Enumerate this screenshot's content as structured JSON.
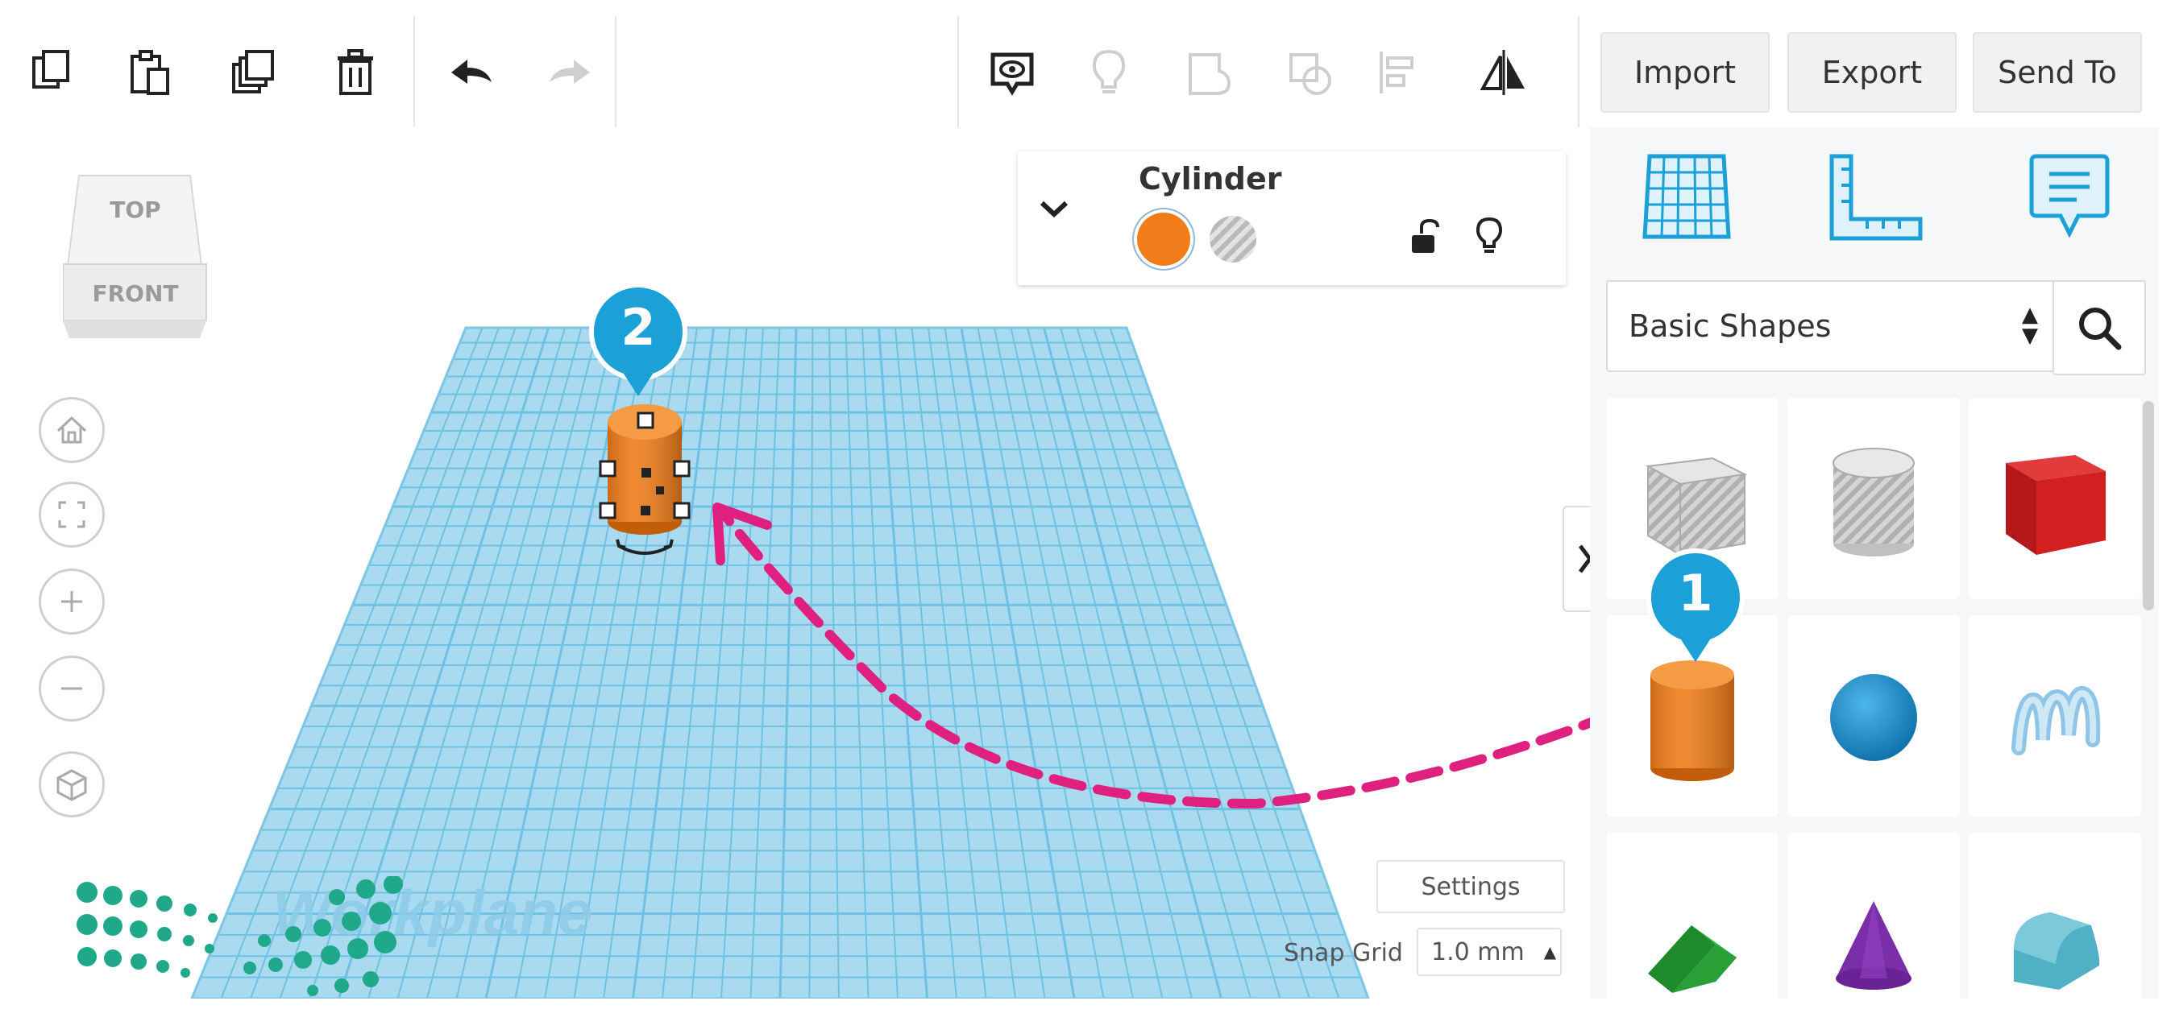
{
  "toolbar": {
    "buttons_left": [
      "copy-icon",
      "paste-icon",
      "duplicate-icon",
      "delete-icon",
      "undo-icon",
      "redo-icon"
    ],
    "buttons_center": [
      "notes-visibility-icon",
      "light-bulb-icon",
      "group-icon",
      "ungroup-icon",
      "align-icon",
      "mirror-icon"
    ],
    "import_label": "Import",
    "export_label": "Export",
    "send_to_label": "Send To"
  },
  "viewcube": {
    "top_label": "TOP",
    "front_label": "FRONT"
  },
  "nav_controls": [
    "home-icon",
    "fit-view-icon",
    "zoom-in-icon",
    "zoom-out-icon",
    "perspective-icon"
  ],
  "inspector": {
    "shape_name": "Cylinder",
    "solid_color": "#f07d1a"
  },
  "workplane": {
    "label": "Workplane",
    "settings_label": "Settings",
    "snap_grid_label": "Snap Grid",
    "snap_grid_value": "1.0 mm"
  },
  "callouts": {
    "step1": "1",
    "step2": "2"
  },
  "panel": {
    "view_icons": [
      "grid-icon",
      "ruler-icon",
      "notes-icon"
    ],
    "category": "Basic Shapes",
    "shapes": [
      "box-hole",
      "cylinder-hole",
      "box",
      "cylinder",
      "sphere",
      "scribble",
      "roof",
      "cone",
      "round-roof"
    ]
  },
  "colors": {
    "accent_blue": "#1ba0d7",
    "workplane": "#9fd6ee",
    "grid_line": "#6fc1e3",
    "orange": "#f07d1a",
    "arrow_pink": "#e0207f"
  }
}
